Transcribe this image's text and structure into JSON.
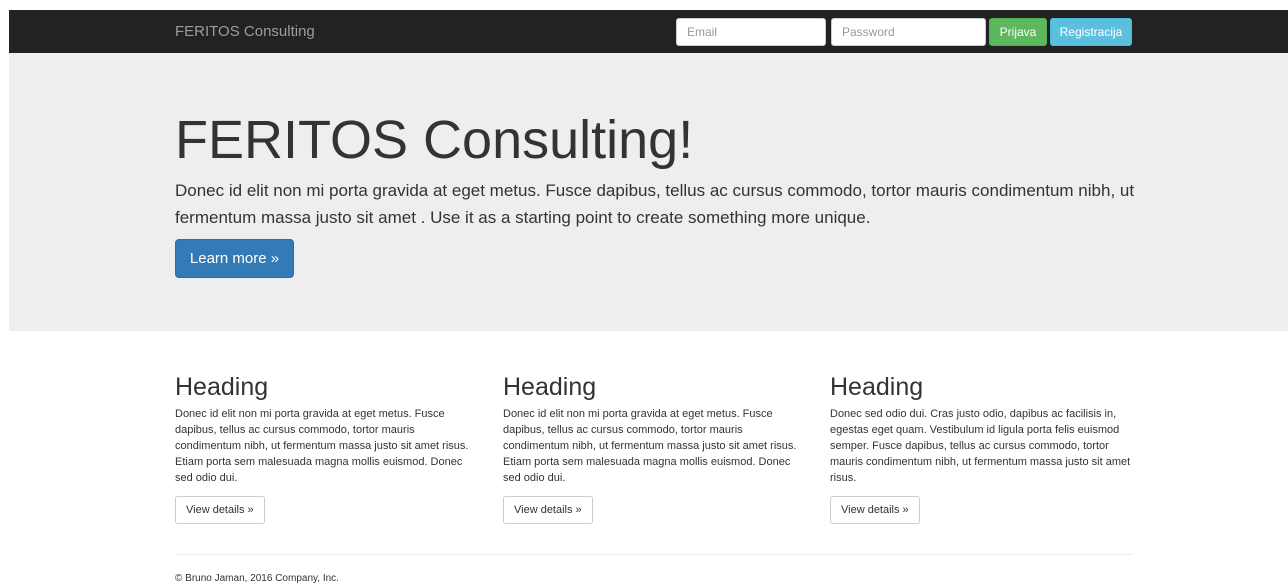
{
  "navbar": {
    "brand": "FERITOS Consulting",
    "email_placeholder": "Email",
    "password_placeholder": "Password",
    "login_label": "Prijava",
    "register_label": "Registracija"
  },
  "jumbotron": {
    "title": "FERITOS Consulting!",
    "text": "Donec id elit non mi porta gravida at eget metus. Fusce dapibus, tellus ac cursus commodo, tortor mauris condimentum nibh, ut fermentum massa justo sit amet . Use it as a starting point to create something more unique.",
    "button_label": "Learn more »"
  },
  "columns": [
    {
      "heading": "Heading",
      "text": "Donec id elit non mi porta gravida at eget metus. Fusce dapibus, tellus ac cursus commodo, tortor mauris condimentum nibh, ut fermentum massa justo sit amet risus. Etiam porta sem malesuada magna mollis euismod. Donec sed odio dui.",
      "button_label": "View details »"
    },
    {
      "heading": "Heading",
      "text": "Donec id elit non mi porta gravida at eget metus. Fusce dapibus, tellus ac cursus commodo, tortor mauris condimentum nibh, ut fermentum massa justo sit amet risus. Etiam porta sem malesuada magna mollis euismod. Donec sed odio dui.",
      "button_label": "View details »"
    },
    {
      "heading": "Heading",
      "text": "Donec sed odio dui. Cras justo odio, dapibus ac facilisis in, egestas eget quam. Vestibulum id ligula porta felis euismod semper. Fusce dapibus, tellus ac cursus commodo, tortor mauris condimentum nibh, ut fermentum massa justo sit amet risus.",
      "button_label": "View details »"
    }
  ],
  "footer": {
    "text": "© Bruno Jaman, 2016 Company, Inc."
  },
  "colors": {
    "navbar_bg": "#222222",
    "jumbotron_bg": "#eeeeee",
    "primary": "#337ab7",
    "success": "#5cb85c",
    "info": "#5bc0de"
  }
}
